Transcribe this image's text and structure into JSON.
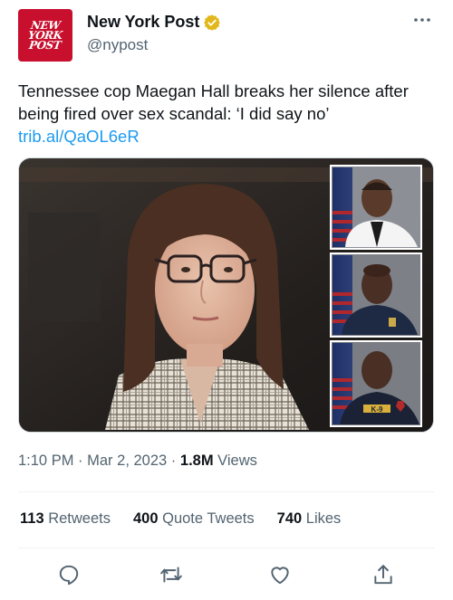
{
  "account": {
    "logo_lines": [
      "NEW",
      "YORK",
      "POST"
    ],
    "display_name": "New York Post",
    "handle": "@nypost",
    "verified_color": "#e2b719"
  },
  "tweet": {
    "text": "Tennessee cop Maegan Hall breaks her silence after being fired over sex scandal: ‘I did say no’",
    "link": "trib.al/QaOL6eR"
  },
  "meta": {
    "time": "1:10 PM",
    "date": "Mar 2, 2023",
    "views_count": "1.8M",
    "views_label": "Views"
  },
  "stats": {
    "retweets_count": "113",
    "retweets_label": "Retweets",
    "quotes_count": "400",
    "quotes_label": "Quote Tweets",
    "likes_count": "740",
    "likes_label": "Likes"
  },
  "media": {
    "badge_text": "K-9"
  },
  "colors": {
    "link": "#1d9bf0",
    "secondary_text": "#536471",
    "logo_red": "#c8102e"
  }
}
